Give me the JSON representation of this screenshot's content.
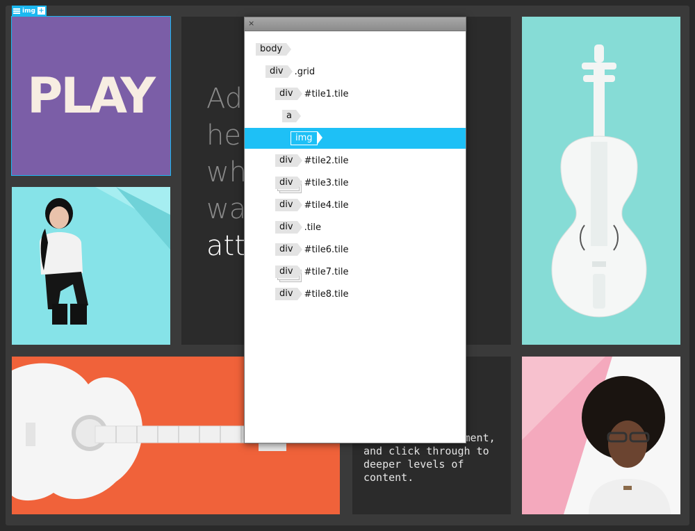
{
  "selection": {
    "tag_label": "img",
    "add_label": "+"
  },
  "tiles": {
    "play": {
      "text": "PLAY",
      "bg": "#7b5ea7",
      "fg": "#f7ede2"
    },
    "center": {
      "lines": [
        "Add",
        "here",
        "wha",
        "wan"
      ],
      "highlight": "att"
    },
    "bottom_text": {
      "text": "Add action statement, and click through to deeper levels of content."
    }
  },
  "colors": {
    "accent": "#1ec0f6",
    "violin_bg": "#86dcd6",
    "guitar_bg": "#f0623a",
    "woman_bg": "#86e3e8",
    "man_bg": "#f4a9bd"
  },
  "panel": {
    "close_label": "×",
    "nodes": [
      {
        "tag": "body",
        "label": "",
        "indent": 0,
        "stacked": false,
        "selected": false
      },
      {
        "tag": "div",
        "label": ".grid",
        "indent": 1,
        "stacked": false,
        "selected": false
      },
      {
        "tag": "div",
        "label": "#tile1.tile",
        "indent": 2,
        "stacked": false,
        "selected": false
      },
      {
        "tag": "a",
        "label": "",
        "indent": 3,
        "stacked": false,
        "selected": false
      },
      {
        "tag": "img",
        "label": "",
        "indent": 4,
        "stacked": false,
        "selected": true
      },
      {
        "tag": "div",
        "label": "#tile2.tile",
        "indent": 2,
        "stacked": false,
        "selected": false
      },
      {
        "tag": "div",
        "label": "#tile3.tile",
        "indent": 2,
        "stacked": true,
        "selected": false
      },
      {
        "tag": "div",
        "label": "#tile4.tile",
        "indent": 2,
        "stacked": false,
        "selected": false
      },
      {
        "tag": "div",
        "label": ".tile",
        "indent": 2,
        "stacked": false,
        "selected": false
      },
      {
        "tag": "div",
        "label": "#tile6.tile",
        "indent": 2,
        "stacked": false,
        "selected": false
      },
      {
        "tag": "div",
        "label": "#tile7.tile",
        "indent": 2,
        "stacked": true,
        "selected": false
      },
      {
        "tag": "div",
        "label": "#tile8.tile",
        "indent": 2,
        "stacked": false,
        "selected": false
      }
    ]
  }
}
